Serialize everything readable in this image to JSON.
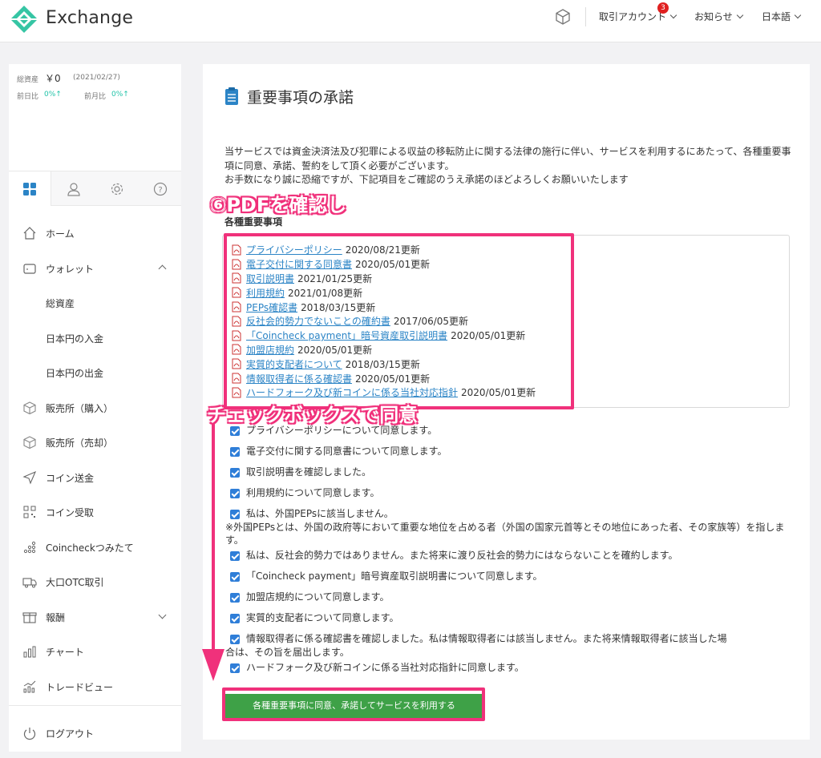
{
  "header": {
    "brand": "Exchange",
    "account_label": "取引アカウント",
    "account_badge": "3",
    "notice_label": "お知らせ",
    "language_label": "日本語"
  },
  "sidebar": {
    "assets_label": "総資産",
    "assets_value": "￥0",
    "assets_date": "(2021/02/27)",
    "day_label": "前日比",
    "day_value": "0%↑",
    "month_label": "前月比",
    "month_value": "0%↑",
    "items": [
      {
        "label": "ホーム"
      },
      {
        "label": "ウォレット"
      },
      {
        "label": "総資産"
      },
      {
        "label": "日本円の入金"
      },
      {
        "label": "日本円の出金"
      },
      {
        "label": "販売所（購入）"
      },
      {
        "label": "販売所（売却）"
      },
      {
        "label": "コイン送金"
      },
      {
        "label": "コイン受取"
      },
      {
        "label": "Coincheckつみたて"
      },
      {
        "label": "大口OTC取引"
      },
      {
        "label": "報酬"
      },
      {
        "label": "チャート"
      },
      {
        "label": "トレードビュー"
      },
      {
        "label": "ログアウト"
      }
    ]
  },
  "main": {
    "title": "重要事項の承諾",
    "intro1": "当サービスでは資金決済法及び犯罪による収益の移転防止に関する法律の施行に伴い、サービスを利用するにあたって、各種重要事項に同意、承諾、誓約をして頂く必要がございます。",
    "intro2": "お手数になり誠に恐縮ですが、下記項目をご確認のうえ承諾のほどよろしくお願いいたします",
    "section_head": "各種重要事項",
    "documents": [
      {
        "name": "プライバシーポリシー",
        "date": "2020/08/21更新"
      },
      {
        "name": "電子交付に関する同意書",
        "date": "2020/05/01更新"
      },
      {
        "name": "取引説明書",
        "date": "2021/01/25更新"
      },
      {
        "name": "利用規約",
        "date": "2021/01/08更新"
      },
      {
        "name": "PEPs確認書",
        "date": "2018/03/15更新"
      },
      {
        "name": "反社会的勢力でないことの確約書",
        "date": "2017/06/05更新"
      },
      {
        "name": "「Coincheck payment」暗号資産取引説明書",
        "date": "2020/05/01更新"
      },
      {
        "name": "加盟店規約",
        "date": "2020/05/01更新"
      },
      {
        "name": "実質的支配者について",
        "date": "2018/03/15更新"
      },
      {
        "name": "情報取得者に係る確認書",
        "date": "2020/05/01更新"
      },
      {
        "name": "ハードフォーク及び新コインに係る当社対応指針",
        "date": "2020/05/01更新"
      }
    ],
    "checks": [
      {
        "text": "プライバシーポリシーについて同意します。"
      },
      {
        "text": "電子交付に関する同意書について同意します。"
      },
      {
        "text": "取引説明書を確認しました。"
      },
      {
        "text": "利用規約について同意します。"
      },
      {
        "text": "私は、外国PEPsに該当しません。",
        "note": "※外国PEPsとは、外国の政府等において重要な地位を占める者（外国の国家元首等とその地位にあった者、その家族等）を指します。"
      },
      {
        "text": "私は、反社会的勢力ではありません。また将来に渡り反社会的勢力にはならないことを確約します。"
      },
      {
        "text": "「Coincheck payment」暗号資産取引説明書について同意します。"
      },
      {
        "text": "加盟店規約について同意します。"
      },
      {
        "text": "実質的支配者について同意します。"
      },
      {
        "text": "情報取得者に係る確認書を確認しました。私は情報取得者には該当しません。また将来情報取得者に該当した場",
        "note": "合は、その旨を届出します。"
      },
      {
        "text": "ハードフォーク及び新コインに係る当社対応指針に同意します。"
      }
    ],
    "submit_label": "各種重要事項に同意、承諾してサービスを利用する"
  },
  "annotations": {
    "pdf_note": "⑥PDFを確認し",
    "check_note": "チェックボックスで同意",
    "highlight_color": "#f0317b"
  }
}
